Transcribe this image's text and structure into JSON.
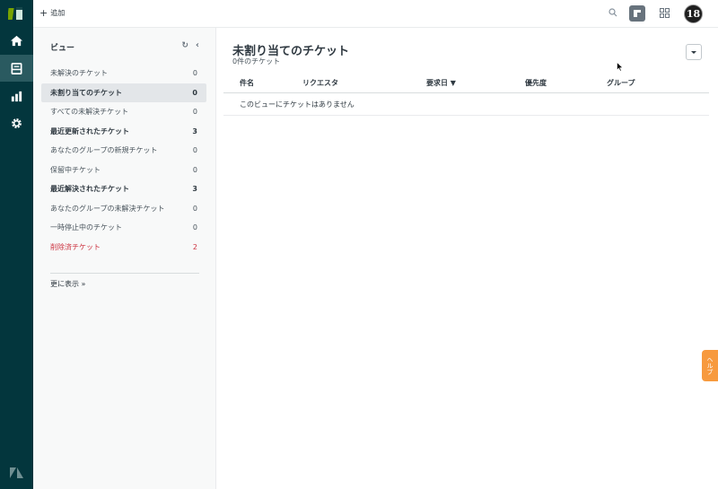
{
  "topbar": {
    "add_label": "追加",
    "avatar_text": "18"
  },
  "views": {
    "title": "ビュー",
    "items": [
      {
        "label": "未解決のチケット",
        "count": "0",
        "style": "normal"
      },
      {
        "label": "未割り当てのチケット",
        "count": "0",
        "style": "selected"
      },
      {
        "label": "すべての未解決チケット",
        "count": "0",
        "style": "normal"
      },
      {
        "label": "最近更新されたチケット",
        "count": "3",
        "style": "bold"
      },
      {
        "label": "あなたのグループの新規チケット",
        "count": "0",
        "style": "normal"
      },
      {
        "label": "保留中チケット",
        "count": "0",
        "style": "normal"
      },
      {
        "label": "最近解決されたチケット",
        "count": "3",
        "style": "bold"
      },
      {
        "label": "あなたのグループの未解決チケット",
        "count": "0",
        "style": "normal"
      },
      {
        "label": "一時停止中のチケット",
        "count": "0",
        "style": "normal"
      },
      {
        "label": "削除済チケット",
        "count": "2",
        "style": "danger"
      }
    ],
    "more_label": "更に表示 »"
  },
  "main": {
    "title": "未割り当てのチケット",
    "subtitle": "0件のチケット",
    "columns": [
      "件名",
      "リクエスタ",
      "要求日 ▼",
      "優先度",
      "グループ"
    ],
    "empty_message": "このビューにチケットはありません"
  },
  "help": {
    "label": "ヘルプ"
  },
  "colors": {
    "rail": "#03363d",
    "accent_help": "#f79a3e",
    "danger": "#cc3340"
  }
}
